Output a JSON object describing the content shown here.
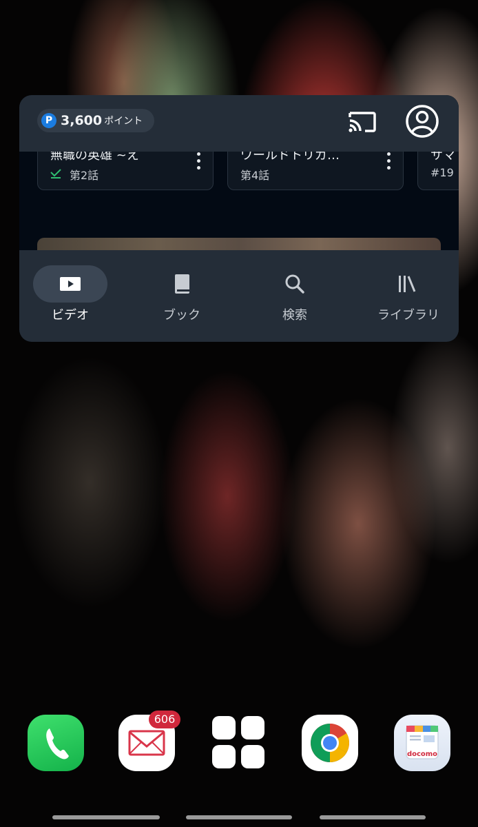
{
  "widget": {
    "points": {
      "badge": "P",
      "value": "3,600",
      "unit": "ポイント"
    },
    "header_icons": {
      "cast": "cast-icon",
      "account": "account-circle-icon"
    },
    "cards": [
      {
        "title": "無職の英雄 ~え",
        "episode": "第2話",
        "watched": true
      },
      {
        "title": "ワールドトリガ…",
        "episode": "第4話",
        "watched": false
      },
      {
        "title": "サマ",
        "episode": "#19",
        "watched": false
      }
    ],
    "nav": [
      {
        "label": "ビデオ",
        "icon": "video-play-icon",
        "active": true
      },
      {
        "label": "ブック",
        "icon": "book-icon",
        "active": false
      },
      {
        "label": "検索",
        "icon": "search-icon",
        "active": false
      },
      {
        "label": "ライブラリ",
        "icon": "library-icon",
        "active": false
      }
    ]
  },
  "dock": {
    "apps": [
      {
        "name": "phone",
        "icon": "phone-icon"
      },
      {
        "name": "mail",
        "icon": "mail-icon",
        "badge": "606"
      },
      {
        "name": "apps",
        "icon": "app-drawer-icon"
      },
      {
        "name": "chrome",
        "icon": "chrome-icon"
      },
      {
        "name": "docomo",
        "icon": "docomo-icon",
        "label": "docomo"
      }
    ]
  },
  "colors": {
    "widget_bg": "#242d38",
    "accent_blue": "#1b7ce0",
    "badge_red": "#d0283c",
    "check_green": "#2fbf71"
  }
}
